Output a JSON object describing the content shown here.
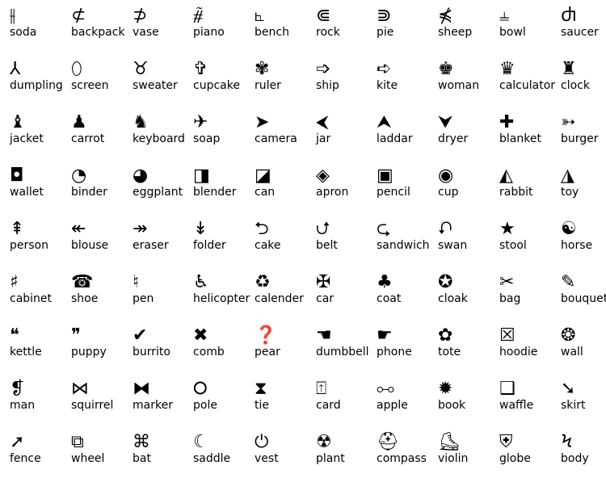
{
  "items": [
    {
      "label": "soda",
      "glyph": "⫲",
      "icon": "parallel-with-stroke-icon"
    },
    {
      "label": "backpack",
      "glyph": "⊄",
      "icon": "not-subset-icon"
    },
    {
      "label": "vase",
      "glyph": "⊅",
      "icon": "not-superset-icon"
    },
    {
      "label": "piano",
      "glyph": "⧤",
      "icon": "strike-glyph-icon"
    },
    {
      "label": "bench",
      "glyph": "⦜",
      "icon": "right-angle-icon"
    },
    {
      "label": "rock",
      "glyph": "⋐",
      "icon": "double-subset-icon"
    },
    {
      "label": "pie",
      "glyph": "⋑",
      "icon": "double-superset-icon"
    },
    {
      "label": "sheep",
      "glyph": "⋠",
      "icon": "not-precedes-icon"
    },
    {
      "label": "bowl",
      "glyph": "⫨",
      "icon": "crossed-tack-icon"
    },
    {
      "label": "saucer",
      "glyph": "Ⴛ",
      "icon": "d-letter-icon"
    },
    {
      "label": "dumpling",
      "glyph": "⅄",
      "icon": "turned-y-icon"
    },
    {
      "label": "screen",
      "glyph": "⬯",
      "icon": "lens-icon"
    },
    {
      "label": "sweater",
      "glyph": "♉",
      "icon": "taurus-icon"
    },
    {
      "label": "cupcake",
      "glyph": "✞",
      "icon": "latin-cross-icon"
    },
    {
      "label": "ruler",
      "glyph": "✾",
      "icon": "florette-icon"
    },
    {
      "label": "ship",
      "glyph": "➩",
      "icon": "outlined-arrow-icon"
    },
    {
      "label": "kite",
      "glyph": "➪",
      "icon": "outlined-back-arrow-icon"
    },
    {
      "label": "woman",
      "glyph": "♚",
      "icon": "chess-king-icon"
    },
    {
      "label": "calculator",
      "glyph": "♛",
      "icon": "chess-queen-icon"
    },
    {
      "label": "clock",
      "glyph": "♜",
      "icon": "chess-rook-icon"
    },
    {
      "label": "jacket",
      "glyph": "♝",
      "icon": "chess-bishop-icon"
    },
    {
      "label": "carrot",
      "glyph": "♟",
      "icon": "chess-pawn-icon"
    },
    {
      "label": "keyboard",
      "glyph": "♞",
      "icon": "chess-knight-icon"
    },
    {
      "label": "soap",
      "glyph": "✈",
      "icon": "airplane-icon"
    },
    {
      "label": "camera",
      "glyph": "➤",
      "icon": "arrowhead-right-icon"
    },
    {
      "label": "jar",
      "glyph": "⮜",
      "icon": "arrowhead-left-icon"
    },
    {
      "label": "laddar",
      "glyph": "⮝",
      "icon": "arrowhead-up-icon"
    },
    {
      "label": "dryer",
      "glyph": "⮟",
      "icon": "arrowhead-down-icon"
    },
    {
      "label": "blanket",
      "glyph": "✚",
      "icon": "plus-icon"
    },
    {
      "label": "burger",
      "glyph": "➳",
      "icon": "feathered-arrow-icon"
    },
    {
      "label": "wallet",
      "glyph": "◘",
      "icon": "inverse-bullet-icon"
    },
    {
      "label": "binder",
      "glyph": "◔",
      "icon": "quarter-circle-icon"
    },
    {
      "label": "eggplant",
      "glyph": "◕",
      "icon": "three-quarter-circle-icon"
    },
    {
      "label": "blender",
      "glyph": "◨",
      "icon": "half-square-icon"
    },
    {
      "label": "can",
      "glyph": "◪",
      "icon": "diagonal-half-square-icon"
    },
    {
      "label": "apron",
      "glyph": "◈",
      "icon": "diamond-in-diamond-icon"
    },
    {
      "label": "pencil",
      "glyph": "▣",
      "icon": "square-in-square-icon"
    },
    {
      "label": "cup",
      "glyph": "◉",
      "icon": "fisheye-icon"
    },
    {
      "label": "rabbit",
      "glyph": "◭",
      "icon": "half-triangle-icon"
    },
    {
      "label": "toy",
      "glyph": "◮",
      "icon": "half-triangle-right-icon"
    },
    {
      "label": "person",
      "glyph": "⇞",
      "icon": "double-up-arrow-icon"
    },
    {
      "label": "blouse",
      "glyph": "↞",
      "icon": "double-left-arrow-icon"
    },
    {
      "label": "eraser",
      "glyph": "↠",
      "icon": "double-right-arrow-icon"
    },
    {
      "label": "folder",
      "glyph": "↡",
      "icon": "double-down-arrow-icon"
    },
    {
      "label": "cake",
      "glyph": "⮌",
      "icon": "circle-left-arrow-icon"
    },
    {
      "label": "belt",
      "glyph": "⮍",
      "icon": "circle-up-arrow-icon"
    },
    {
      "label": "sandwich",
      "glyph": "⮎",
      "icon": "circle-right-arrow-icon"
    },
    {
      "label": "swan",
      "glyph": "⮏",
      "icon": "circle-down-arrow-icon"
    },
    {
      "label": "stool",
      "glyph": "★",
      "icon": "star-icon"
    },
    {
      "label": "horse",
      "glyph": "☯",
      "icon": "yin-yang-icon"
    },
    {
      "label": "cabinet",
      "glyph": "♯",
      "icon": "sharp-icon"
    },
    {
      "label": "shoe",
      "glyph": "☎",
      "icon": "telephone-icon"
    },
    {
      "label": "pen",
      "glyph": "♮",
      "icon": "natural-icon"
    },
    {
      "label": "helicopter",
      "glyph": "♿",
      "icon": "wheelchair-icon"
    },
    {
      "label": "calender",
      "glyph": "♻",
      "icon": "recycle-icon"
    },
    {
      "label": "car",
      "glyph": "✠",
      "icon": "maltese-cross-icon"
    },
    {
      "label": "coat",
      "glyph": "♣",
      "icon": "club-icon"
    },
    {
      "label": "cloak",
      "glyph": "✪",
      "icon": "circled-star-icon"
    },
    {
      "label": "bag",
      "glyph": "✂",
      "icon": "scissors-icon"
    },
    {
      "label": "bouquet",
      "glyph": "✎",
      "icon": "pencil-icon"
    },
    {
      "label": "kettle",
      "glyph": "❝",
      "icon": "open-quote-icon"
    },
    {
      "label": "puppy",
      "glyph": "❞",
      "icon": "close-quote-icon"
    },
    {
      "label": "burrito",
      "glyph": "✔",
      "icon": "check-icon"
    },
    {
      "label": "comb",
      "glyph": "✖",
      "icon": "x-mark-icon"
    },
    {
      "label": "pear",
      "glyph": "❓",
      "icon": "question-icon"
    },
    {
      "label": "dumbbell",
      "glyph": "☚",
      "icon": "pointing-left-icon"
    },
    {
      "label": "phone",
      "glyph": "☛",
      "icon": "pointing-right-icon"
    },
    {
      "label": "tote",
      "glyph": "✿",
      "icon": "flower-icon"
    },
    {
      "label": "hoodie",
      "glyph": "☒",
      "icon": "x-box-icon"
    },
    {
      "label": "wall",
      "glyph": "❂",
      "icon": "circled-star-burst-icon"
    },
    {
      "label": "man",
      "glyph": "❡",
      "icon": "pilcrow-icon"
    },
    {
      "label": "squirrel",
      "glyph": "⋈",
      "icon": "bowtie-icon"
    },
    {
      "label": "marker",
      "glyph": "⧓",
      "icon": "black-bowtie-icon"
    },
    {
      "label": "pole",
      "glyph": "⭘",
      "icon": "diamond-on-line-icon"
    },
    {
      "label": "tie",
      "glyph": "⧗",
      "icon": "hourglass-icon"
    },
    {
      "label": "card",
      "glyph": "⍐",
      "icon": "box-on-line-icon"
    },
    {
      "label": "apple",
      "glyph": "⧟",
      "icon": "double-ended-multimap-icon"
    },
    {
      "label": "book",
      "glyph": "✹",
      "icon": "starburst-icon"
    },
    {
      "label": "waffle",
      "glyph": "❑",
      "icon": "shadowed-square-icon"
    },
    {
      "label": "skirt",
      "glyph": "➘",
      "icon": "down-right-arrow-icon"
    },
    {
      "label": "fence",
      "glyph": "➚",
      "icon": "up-right-arrow-icon"
    },
    {
      "label": "wheel",
      "glyph": "⧉",
      "icon": "circled-triangle-icon"
    },
    {
      "label": "bat",
      "glyph": "⌘",
      "icon": "command-key-icon"
    },
    {
      "label": "saddle",
      "glyph": "☾",
      "icon": "crescent-moon-icon"
    },
    {
      "label": "vest",
      "glyph": "⏻",
      "icon": "power-icon"
    },
    {
      "label": "plant",
      "glyph": "☢",
      "icon": "radioactive-icon"
    },
    {
      "label": "compass",
      "glyph": "⛑",
      "icon": "helmet-icon"
    },
    {
      "label": "violin",
      "glyph": "⛸",
      "icon": "ice-skate-icon"
    },
    {
      "label": "globe",
      "glyph": "⛨",
      "icon": "shield-cross-icon"
    },
    {
      "label": "body",
      "glyph": "Ϟ",
      "icon": "lightning-icon"
    }
  ]
}
